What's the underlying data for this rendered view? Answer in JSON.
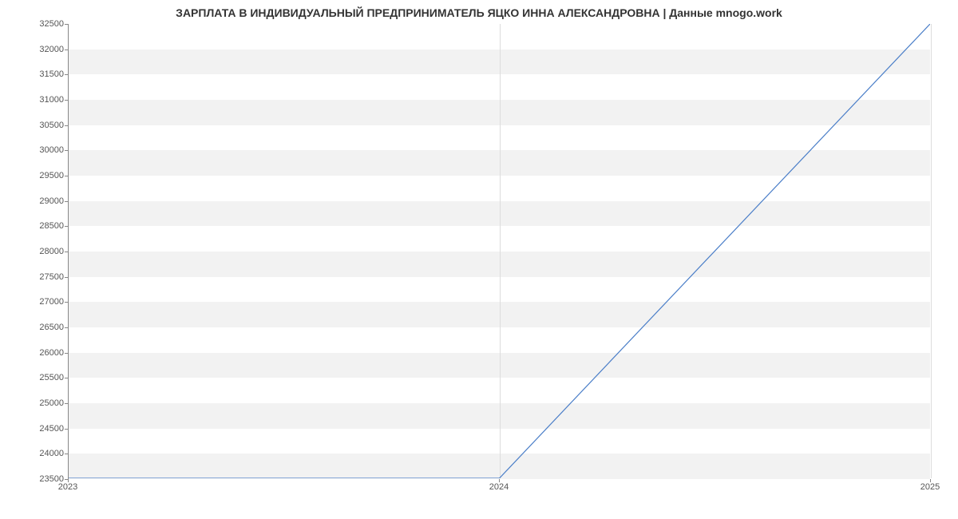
{
  "chart_data": {
    "type": "line",
    "title": "ЗАРПЛАТА В ИНДИВИДУАЛЬНЫЙ ПРЕДПРИНИМАТЕЛЬ ЯЦКО ИННА АЛЕКСАНДРОВНА | Данные mnogo.work",
    "x": [
      2023,
      2024,
      2025
    ],
    "values": [
      23500,
      23500,
      32500
    ],
    "x_ticks": [
      2023,
      2024,
      2025
    ],
    "y_ticks": [
      23500,
      24000,
      24500,
      25000,
      25500,
      26000,
      26500,
      27000,
      27500,
      28000,
      28500,
      29000,
      29500,
      30000,
      30500,
      31000,
      31500,
      32000,
      32500
    ],
    "xlabel": "",
    "ylabel": "",
    "xlim": [
      2023,
      2025
    ],
    "ylim": [
      23500,
      32500
    ],
    "line_color": "#4a7ec8"
  }
}
